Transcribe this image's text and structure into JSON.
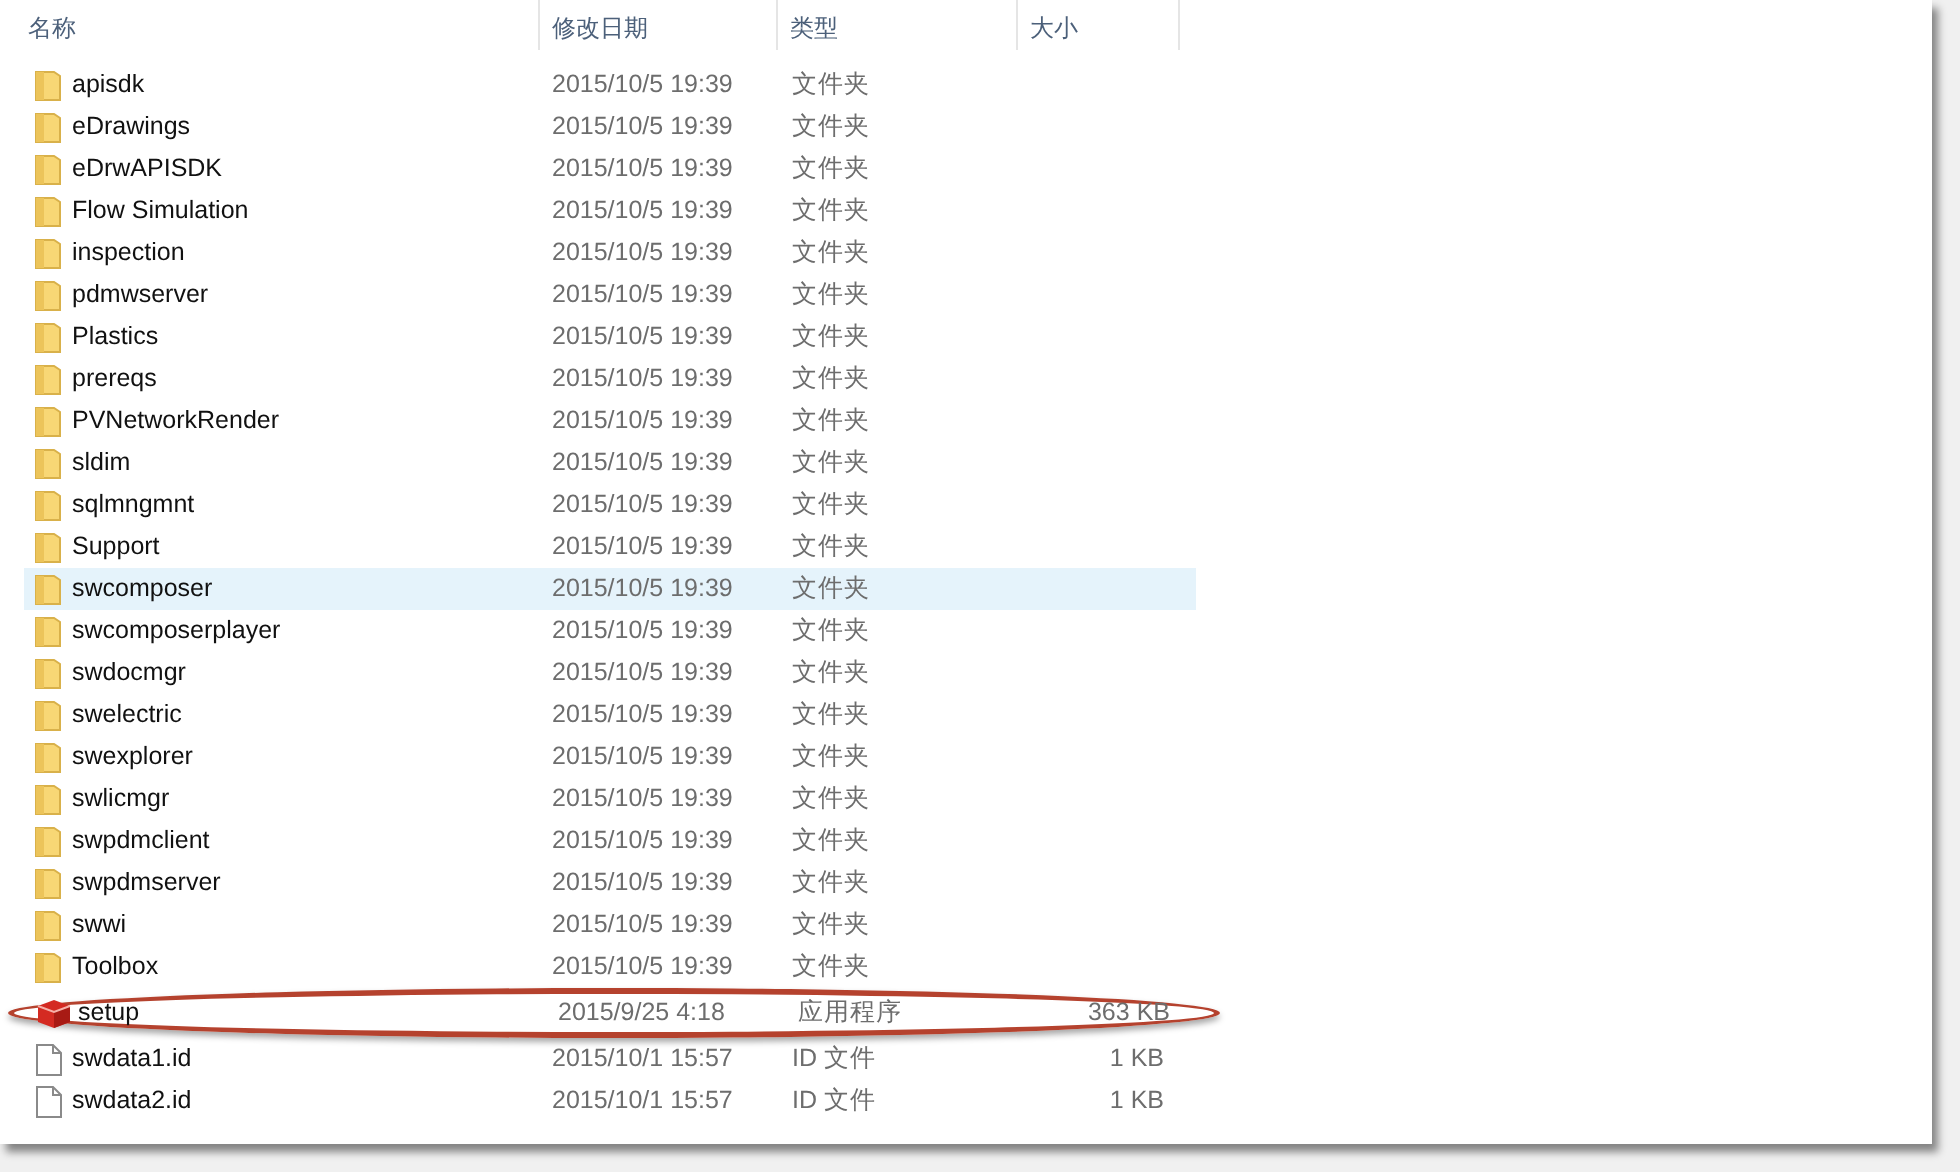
{
  "columns": [
    "名称",
    "修改日期",
    "类型",
    "大小"
  ],
  "rows": [
    {
      "kind": "folder",
      "name": "apisdk",
      "date": "2015/10/5 19:39",
      "type": "文件夹",
      "highlighted": false,
      "circled": false
    },
    {
      "kind": "folder",
      "name": "eDrawings",
      "date": "2015/10/5 19:39",
      "type": "文件夹",
      "highlighted": false,
      "circled": false
    },
    {
      "kind": "folder",
      "name": "eDrwAPISDK",
      "date": "2015/10/5 19:39",
      "type": "文件夹",
      "highlighted": false,
      "circled": false
    },
    {
      "kind": "folder",
      "name": "Flow Simulation",
      "date": "2015/10/5 19:39",
      "type": "文件夹",
      "highlighted": false,
      "circled": false
    },
    {
      "kind": "folder",
      "name": "inspection",
      "date": "2015/10/5 19:39",
      "type": "文件夹",
      "highlighted": false,
      "circled": false
    },
    {
      "kind": "folder",
      "name": "pdmwserver",
      "date": "2015/10/5 19:39",
      "type": "文件夹",
      "highlighted": false,
      "circled": false
    },
    {
      "kind": "folder",
      "name": "Plastics",
      "date": "2015/10/5 19:39",
      "type": "文件夹",
      "highlighted": false,
      "circled": false
    },
    {
      "kind": "folder",
      "name": "prereqs",
      "date": "2015/10/5 19:39",
      "type": "文件夹",
      "highlighted": false,
      "circled": false
    },
    {
      "kind": "folder",
      "name": "PVNetworkRender",
      "date": "2015/10/5 19:39",
      "type": "文件夹",
      "highlighted": false,
      "circled": false
    },
    {
      "kind": "folder",
      "name": "sldim",
      "date": "2015/10/5 19:39",
      "type": "文件夹",
      "highlighted": false,
      "circled": false
    },
    {
      "kind": "folder",
      "name": "sqlmngmnt",
      "date": "2015/10/5 19:39",
      "type": "文件夹",
      "highlighted": false,
      "circled": false
    },
    {
      "kind": "folder",
      "name": "Support",
      "date": "2015/10/5 19:39",
      "type": "文件夹",
      "highlighted": false,
      "circled": false
    },
    {
      "kind": "folder",
      "name": "swcomposer",
      "date": "2015/10/5 19:39",
      "type": "文件夹",
      "highlighted": true,
      "circled": false
    },
    {
      "kind": "folder",
      "name": "swcomposerplayer",
      "date": "2015/10/5 19:39",
      "type": "文件夹",
      "highlighted": false,
      "circled": false
    },
    {
      "kind": "folder",
      "name": "swdocmgr",
      "date": "2015/10/5 19:39",
      "type": "文件夹",
      "highlighted": false,
      "circled": false
    },
    {
      "kind": "folder",
      "name": "swelectric",
      "date": "2015/10/5 19:39",
      "type": "文件夹",
      "highlighted": false,
      "circled": false
    },
    {
      "kind": "folder",
      "name": "swexplorer",
      "date": "2015/10/5 19:39",
      "type": "文件夹",
      "highlighted": false,
      "circled": false
    },
    {
      "kind": "folder",
      "name": "swlicmgr",
      "date": "2015/10/5 19:39",
      "type": "文件夹",
      "highlighted": false,
      "circled": false
    },
    {
      "kind": "folder",
      "name": "swpdmclient",
      "date": "2015/10/5 19:39",
      "type": "文件夹",
      "highlighted": false,
      "circled": false
    },
    {
      "kind": "folder",
      "name": "swpdmserver",
      "date": "2015/10/5 19:39",
      "type": "文件夹",
      "highlighted": false,
      "circled": false
    },
    {
      "kind": "folder",
      "name": "swwi",
      "date": "2015/10/5 19:39",
      "type": "文件夹",
      "highlighted": false,
      "circled": false
    },
    {
      "kind": "folder",
      "name": "Toolbox",
      "date": "2015/10/5 19:39",
      "type": "文件夹",
      "highlighted": false,
      "circled": false
    },
    {
      "kind": "app",
      "name": "setup",
      "date": "2015/9/25 4:18",
      "type": "应用程序",
      "size": "363 KB",
      "highlighted": false,
      "circled": true
    },
    {
      "kind": "file",
      "name": "swdata1.id",
      "date": "2015/10/1 15:57",
      "type": "ID 文件",
      "size": "1 KB",
      "highlighted": false,
      "circled": false
    },
    {
      "kind": "file",
      "name": "swdata2.id",
      "date": "2015/10/1 15:57",
      "type": "ID 文件",
      "size": "1 KB",
      "highlighted": false,
      "circled": false
    }
  ]
}
